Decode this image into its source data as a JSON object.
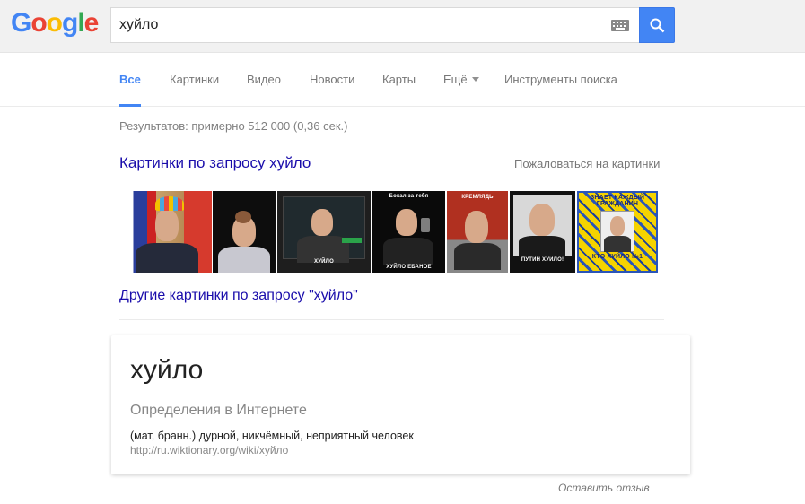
{
  "header": {
    "logo": [
      "G",
      "o",
      "o",
      "g",
      "l",
      "e"
    ],
    "logo_colors": [
      "#4285f4",
      "#ea4335",
      "#fbbc05",
      "#4285f4",
      "#34a853",
      "#ea4335"
    ],
    "search_value": "хуйло",
    "keyboard_icon": "keyboard-icon",
    "search_icon": "search-icon"
  },
  "tabs": {
    "all": "Все",
    "images": "Картинки",
    "video": "Видео",
    "news": "Новости",
    "maps": "Карты",
    "more": "Ещё",
    "tools": "Инструменты поиска"
  },
  "results": {
    "stats": "Результатов: примерно 512 000 (0,36 сек.)",
    "images_heading": "Картинки по запросу хуйло",
    "report_images": "Пожаловаться на картинки",
    "thumbnails": [
      {
        "caption": ""
      },
      {
        "caption": ""
      },
      {
        "caption": "ХУЙЛО"
      },
      {
        "caption_top": "Бокал за тебя",
        "caption": "ХУЙЛО ЕБАНОЕ"
      },
      {
        "caption_top": "КРЕМЛЯДЬ",
        "caption": ""
      },
      {
        "caption": "ПУТИН ХУЙЛО!"
      },
      {
        "caption_top": "ЗНАЕТ КАЖДЫЙ ГРАЖДАНИН",
        "caption": "КТО ХУЙЛО №1"
      }
    ],
    "more_images": "Другие картинки по запросу \"хуйло\""
  },
  "definition": {
    "term": "хуйло",
    "source_heading": "Определения в Интернете",
    "text": "(мат, бранн.) дурной, никчёмный, неприятный человек",
    "url": "http://ru.wiktionary.org/wiki/хуйло"
  },
  "footer": {
    "feedback": "Оставить отзыв"
  },
  "colors": {
    "accent": "#4285f4",
    "link": "#1a0dab"
  }
}
